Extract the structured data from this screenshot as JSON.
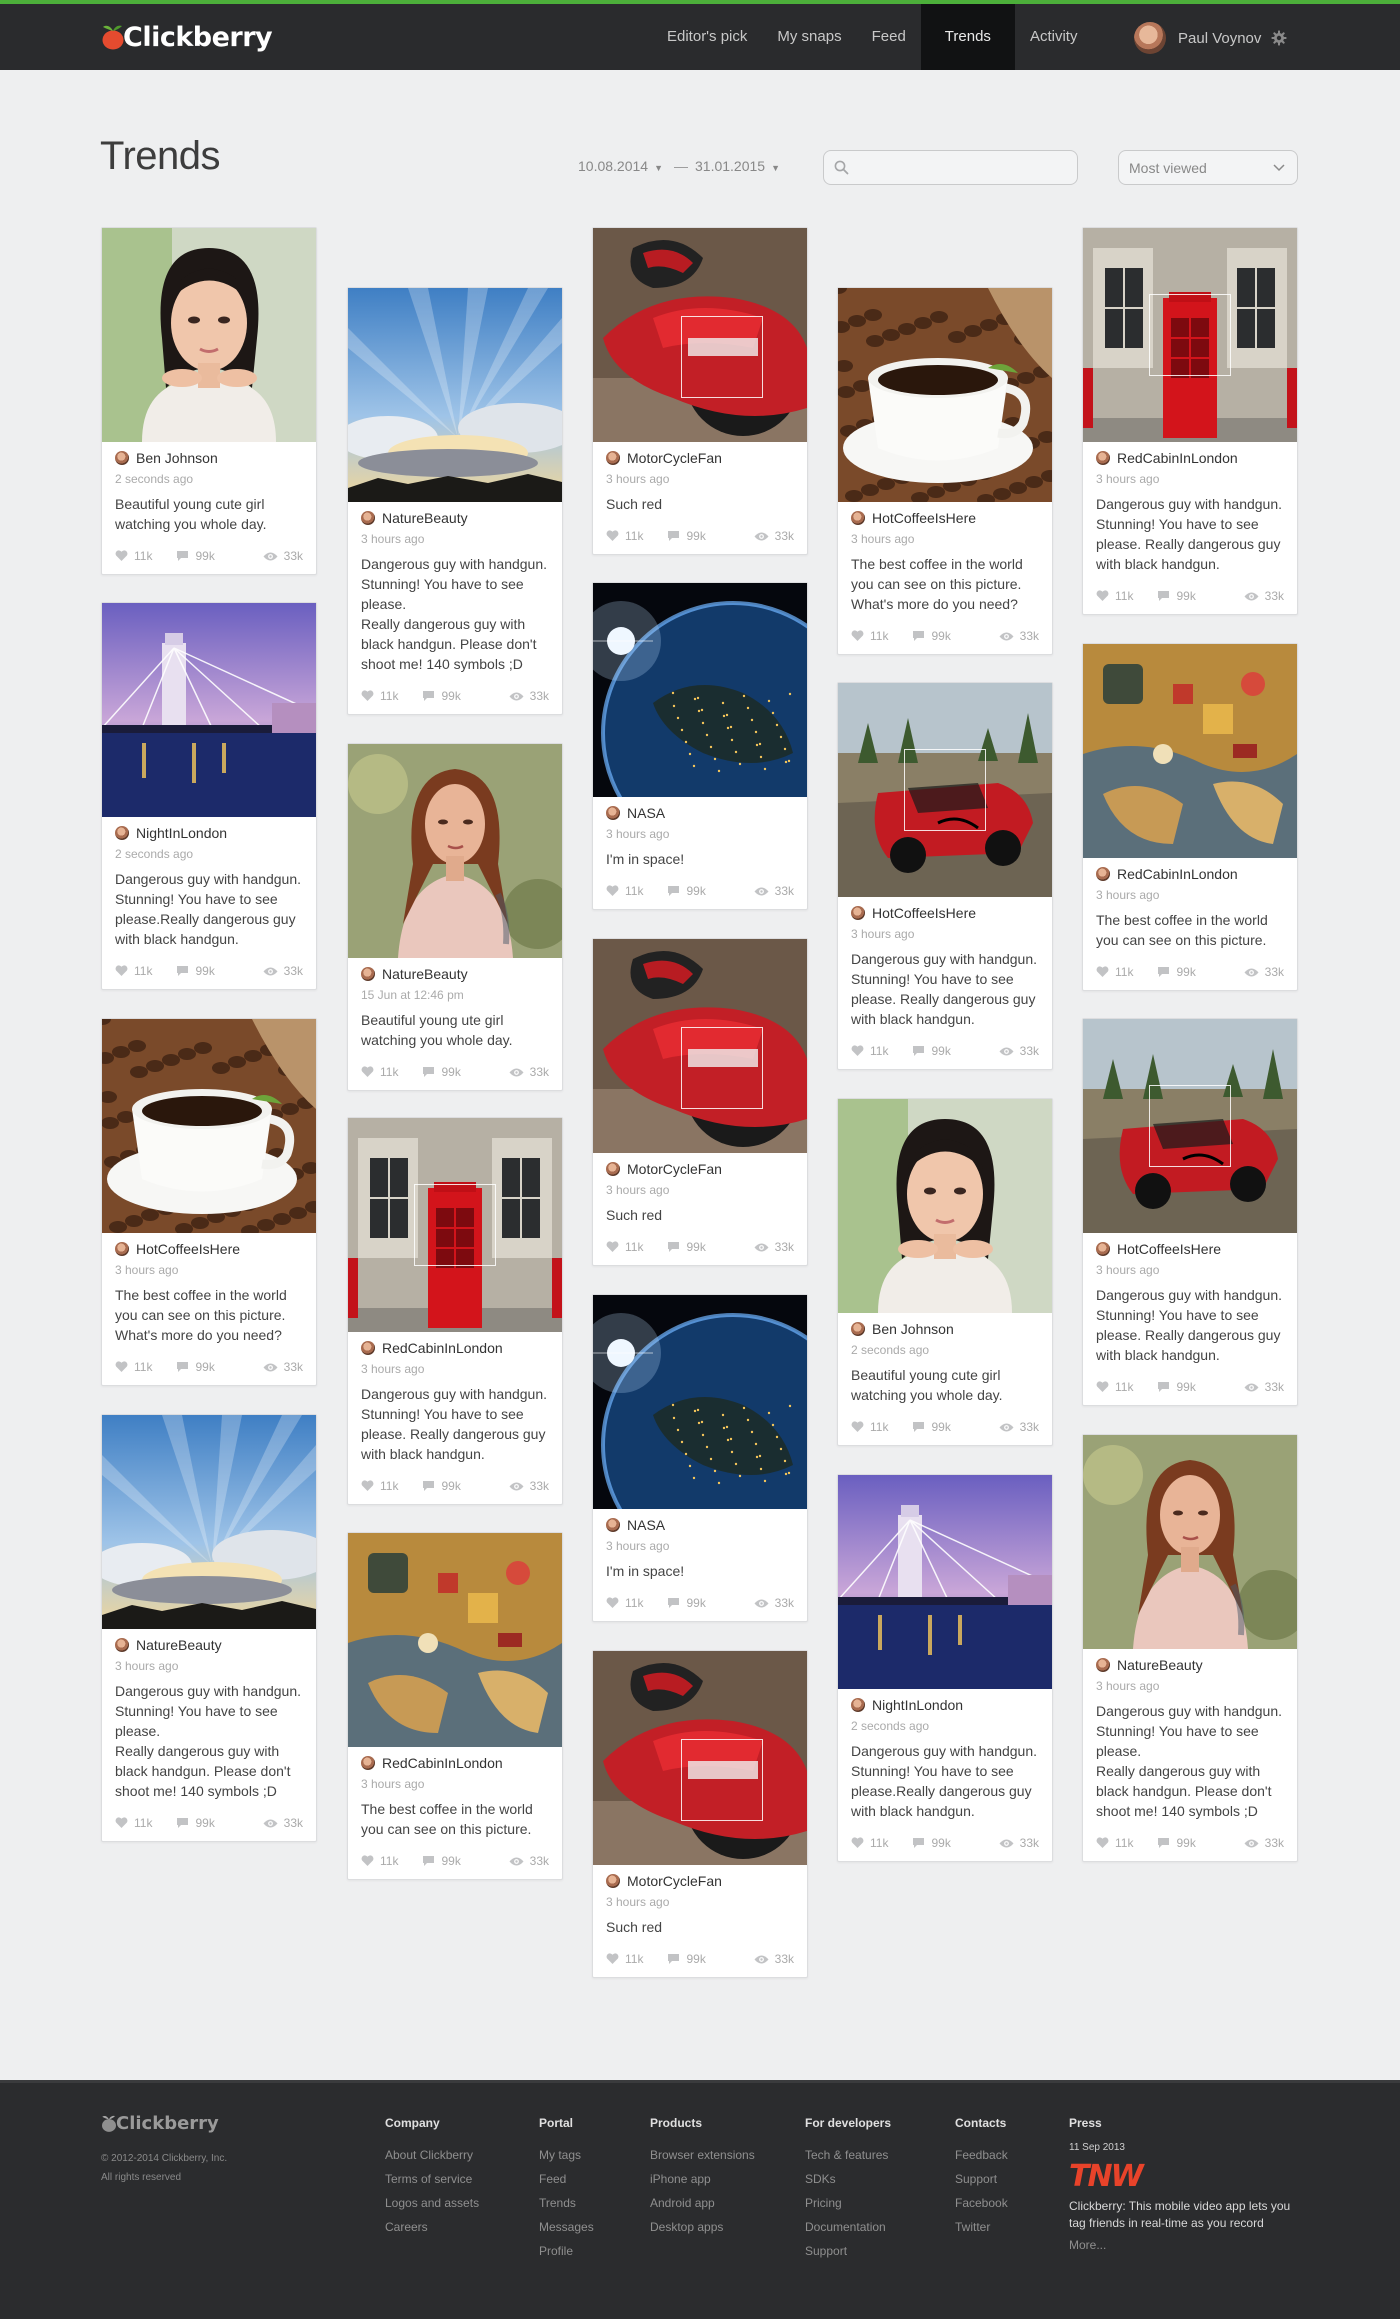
{
  "header": {
    "logo_text": "Clickberry",
    "nav": [
      "Editor's pick",
      "My snaps",
      "Feed",
      "Trends",
      "Activity"
    ],
    "active_nav": "Trends",
    "user_name": "Paul Voynov"
  },
  "page": {
    "title": "Trends",
    "date_from": "10.08.2014",
    "date_sep": "—",
    "date_to": "31.01.2015",
    "search_value": "",
    "search_placeholder": "",
    "sort_value": "Most viewed"
  },
  "colors": {
    "accent": "#4caf3a",
    "topbar": "#2a2b2d",
    "background": "#eeeff0",
    "footer": "#2b2c2e",
    "tnw": "#e8432a"
  },
  "image_types": {
    "girl": "portrait-girl-photo",
    "sky": "sunbeam-sky-photo",
    "moto": "motorcycle-photo",
    "coffee": "coffee-cup-photo",
    "phonebox": "red-phone-box-photo",
    "london": "london-bridge-night-photo",
    "woman": "woman-portrait-photo",
    "earth": "earth-from-space-photo",
    "race": "race-car-photo",
    "game": "board-game-photo"
  },
  "cards": [
    {
      "image": "girl",
      "author": "Ben Johnson",
      "time": "2 seconds ago",
      "text": "Beautiful young cute girl watching you whole day.",
      "likes": "11k",
      "comments": "99k",
      "views": "33k"
    },
    {
      "image": "london",
      "author": "NightInLondon",
      "time": "2 seconds ago",
      "text": "Dangerous guy with handgun. Stunning! You have to see please.Really dangerous guy with black handgun.",
      "likes": "11k",
      "comments": "99k",
      "views": "33k"
    },
    {
      "image": "coffee",
      "author": "HotCoffeeIsHere",
      "time": "3 hours ago",
      "text": "The best coffee in the world you can see on this picture. What's more do you need?",
      "likes": "11k",
      "comments": "99k",
      "views": "33k"
    },
    {
      "image": "sky",
      "author": "NatureBeauty",
      "time": "3 hours ago",
      "text": "Dangerous guy with handgun. Stunning! You have to see please.\nReally dangerous guy with black handgun. Please don't shoot me! 140 symbols ;D",
      "likes": "11k",
      "comments": "99k",
      "views": "33k"
    },
    {
      "image": "sky",
      "author": "NatureBeauty",
      "time": "3 hours ago",
      "text": "Dangerous guy with handgun. Stunning! You have to see please.\nReally dangerous guy with black handgun. Please don't shoot me! 140 symbols ;D",
      "likes": "11k",
      "comments": "99k",
      "views": "33k"
    },
    {
      "image": "woman",
      "author": "NatureBeauty",
      "time": "15 Jun at 12:46 pm",
      "text": "Beautiful young ute girl watching you whole day.",
      "likes": "11k",
      "comments": "99k",
      "views": "33k"
    },
    {
      "image": "phonebox",
      "author": "RedCabinInLondon",
      "time": "3 hours ago",
      "text": "Dangerous guy with handgun. Stunning! You have to see please. Really dangerous guy with black handgun.",
      "likes": "11k",
      "comments": "99k",
      "views": "33k"
    },
    {
      "image": "game",
      "author": "RedCabinInLondon",
      "time": "3 hours ago",
      "text": "The best coffee in the world you can see on this picture.",
      "likes": "11k",
      "comments": "99k",
      "views": "33k"
    },
    {
      "image": "moto",
      "author": "MotorCycleFan",
      "time": "3 hours ago",
      "text": "Such red",
      "likes": "11k",
      "comments": "99k",
      "views": "33k"
    },
    {
      "image": "earth",
      "author": "NASA",
      "time": "3 hours ago",
      "text": "I'm in space!",
      "likes": "11k",
      "comments": "99k",
      "views": "33k"
    },
    {
      "image": "moto",
      "author": "MotorCycleFan",
      "time": "3 hours ago",
      "text": "Such red",
      "likes": "11k",
      "comments": "99k",
      "views": "33k"
    },
    {
      "image": "earth",
      "author": "NASA",
      "time": "3 hours ago",
      "text": "I'm in space!",
      "likes": "11k",
      "comments": "99k",
      "views": "33k"
    },
    {
      "image": "moto",
      "author": "MotorCycleFan",
      "time": "3 hours ago",
      "text": "Such red",
      "likes": "11k",
      "comments": "99k",
      "views": "33k"
    },
    {
      "image": "coffee",
      "author": "HotCoffeeIsHere",
      "time": "3 hours ago",
      "text": "The best coffee in the world you can see on this picture. What's more do you need?",
      "likes": "11k",
      "comments": "99k",
      "views": "33k"
    },
    {
      "image": "race",
      "author": "HotCoffeeIsHere",
      "time": "3 hours ago",
      "text": "Dangerous guy with handgun. Stunning! You have to see please. Really dangerous guy with black handgun.",
      "likes": "11k",
      "comments": "99k",
      "views": "33k"
    },
    {
      "image": "girl",
      "author": "Ben Johnson",
      "time": "2 seconds ago",
      "text": "Beautiful young cute girl watching you whole day.",
      "likes": "11k",
      "comments": "99k",
      "views": "33k"
    },
    {
      "image": "london",
      "author": "NightInLondon",
      "time": "2 seconds ago",
      "text": "Dangerous guy with handgun. Stunning! You have to see please.Really dangerous guy with black handgun.",
      "likes": "11k",
      "comments": "99k",
      "views": "33k"
    },
    {
      "image": "phonebox",
      "author": "RedCabinInLondon",
      "time": "3 hours ago",
      "text": "Dangerous guy with handgun. Stunning! You have to see please. Really dangerous guy with black handgun.",
      "likes": "11k",
      "comments": "99k",
      "views": "33k"
    },
    {
      "image": "game",
      "author": "RedCabinInLondon",
      "time": "3 hours ago",
      "text": "The best coffee in the world you can see on this picture.",
      "likes": "11k",
      "comments": "99k",
      "views": "33k"
    },
    {
      "image": "race",
      "author": "HotCoffeeIsHere",
      "time": "3 hours ago",
      "text": "Dangerous guy with handgun. Stunning! You have to see please. Really dangerous guy with black handgun.",
      "likes": "11k",
      "comments": "99k",
      "views": "33k"
    },
    {
      "image": "woman",
      "author": "NatureBeauty",
      "time": "3 hours ago",
      "text": "Dangerous guy with handgun. Stunning! You have to see please.\nReally dangerous guy with black handgun. Please don't shoot me! 140 symbols ;D",
      "likes": "11k",
      "comments": "99k",
      "views": "33k"
    }
  ],
  "footer": {
    "logo_text": "Clickberry",
    "copyright": "© 2012-2014 Clickberry, Inc.",
    "rights": "All rights reserved",
    "columns": [
      {
        "title": "Company",
        "links": [
          "About Clickberry",
          "Terms of service",
          "Logos and assets",
          "Careers"
        ]
      },
      {
        "title": "Portal",
        "links": [
          "My tags",
          "Feed",
          "Trends",
          "Messages",
          "Profile"
        ]
      },
      {
        "title": "Products",
        "links": [
          "Browser extensions",
          "iPhone app",
          "Android app",
          "Desktop apps"
        ]
      },
      {
        "title": "For developers",
        "links": [
          "Tech & features",
          "SDKs",
          "Pricing",
          "Documentation",
          "Support"
        ]
      },
      {
        "title": "Contacts",
        "links": [
          "Feedback",
          "Support",
          "Facebook",
          "Twitter"
        ]
      }
    ],
    "press": {
      "title": "Press",
      "date": "11 Sep 2013",
      "logo": "TNW",
      "text": "Clickberry: This mobile video app lets you tag friends in real-time as you record",
      "more": "More..."
    }
  }
}
